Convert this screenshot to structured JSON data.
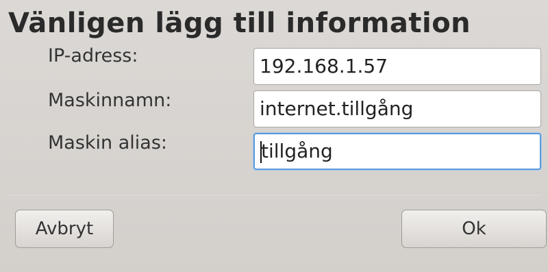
{
  "dialog": {
    "title": "Vänligen lägg till information"
  },
  "form": {
    "ip_label": "IP-adress:",
    "ip_value": "192.168.1.57",
    "hostname_label": "Maskinnamn:",
    "hostname_value": "internet.tillgång",
    "alias_label": "Maskin alias:",
    "alias_value": "tillgång"
  },
  "buttons": {
    "cancel_label": "Avbryt",
    "ok_label": "Ok"
  },
  "colors": {
    "focus_border": "#5a9ad8",
    "background": "#d6d2cf"
  }
}
